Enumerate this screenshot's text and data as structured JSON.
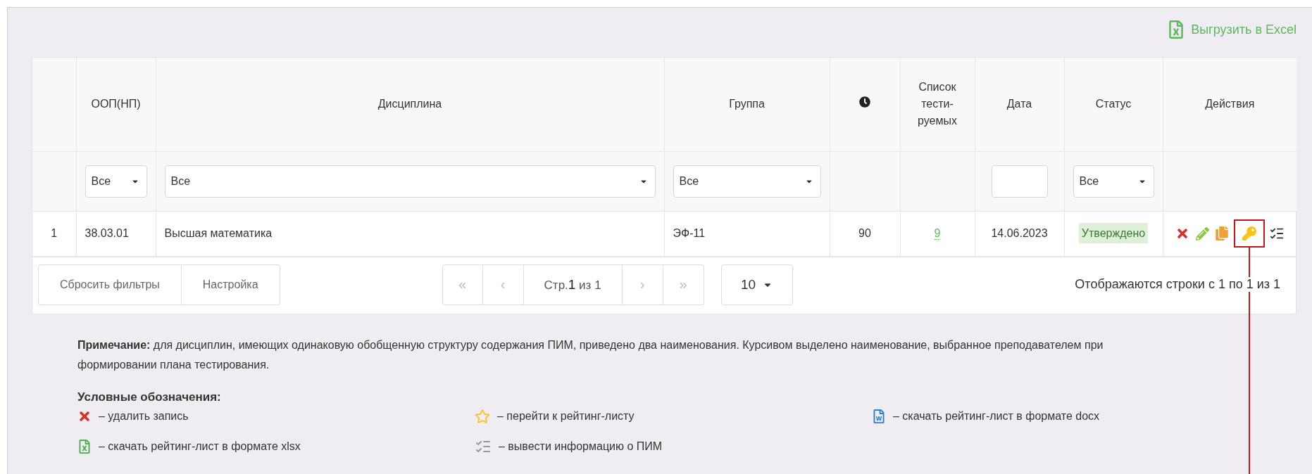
{
  "export_link": "Выгрузить в Excel",
  "table": {
    "columns": [
      {
        "kind": "index"
      },
      {
        "kind": "text",
        "label": "ООП(НП)"
      },
      {
        "kind": "text",
        "label": "Дисциплина"
      },
      {
        "kind": "text",
        "label": "Группа"
      },
      {
        "kind": "clock"
      },
      {
        "kind": "text",
        "label": "Список тести-руемых"
      },
      {
        "kind": "text",
        "label": "Дата"
      },
      {
        "kind": "text",
        "label": "Статус"
      },
      {
        "kind": "text",
        "label": "Действия"
      }
    ],
    "filters": [
      {
        "kind": "none"
      },
      {
        "kind": "select",
        "value": "Все"
      },
      {
        "kind": "select",
        "value": "Все"
      },
      {
        "kind": "select",
        "value": "Все"
      },
      {
        "kind": "none"
      },
      {
        "kind": "none"
      },
      {
        "kind": "input"
      },
      {
        "kind": "select",
        "value": "Все"
      },
      {
        "kind": "none"
      }
    ],
    "rows": [
      {
        "number": "1",
        "oop": "38.03.01",
        "discipline": "Высшая математика",
        "group": "ЭФ-11",
        "duration": "90",
        "tested_count": "9",
        "date": "14.06.2023",
        "status": "Утверждено",
        "actions": [
          {
            "kind": "delete",
            "highlighted": false
          },
          {
            "kind": "edit",
            "highlighted": false
          },
          {
            "kind": "copy",
            "highlighted": false
          },
          {
            "kind": "key",
            "highlighted": true
          },
          {
            "kind": "checklist",
            "highlighted": false
          }
        ]
      }
    ]
  },
  "footer": {
    "buttons": [
      "Сбросить фильтры",
      "Настройка"
    ],
    "pager": [
      {
        "kind": "first",
        "label": "«"
      },
      {
        "kind": "prev",
        "label": "‹"
      },
      {
        "kind": "page",
        "label": "Стр.**1** из 1"
      },
      {
        "kind": "next",
        "label": "›"
      },
      {
        "kind": "last",
        "label": "»"
      }
    ],
    "page_size": "10",
    "summary": "Отображаются строки с 1 по 1 из 1"
  },
  "note": "**Примечание:** для дисциплин, имеющих одинаковую обобщенную структуру содержания ПИМ, приведено два наименования. Курсивом выделено наименование, выбранное преподавателем при формировании плана тестирования.",
  "legend": {
    "title": "Условные обозначения:",
    "items": [
      {
        "kind": "delete",
        "text": "– удалить запись"
      },
      {
        "kind": "star",
        "text": "– перейти к рейтинг-листу"
      },
      {
        "kind": "word",
        "text": "– скачать рейтинг-лист в формате docx"
      },
      {
        "kind": "excel",
        "text": "– скачать рейтинг-лист в формате xlsx"
      },
      {
        "kind": "checklist",
        "text": "– вывести информацию о ПИМ"
      }
    ]
  }
}
